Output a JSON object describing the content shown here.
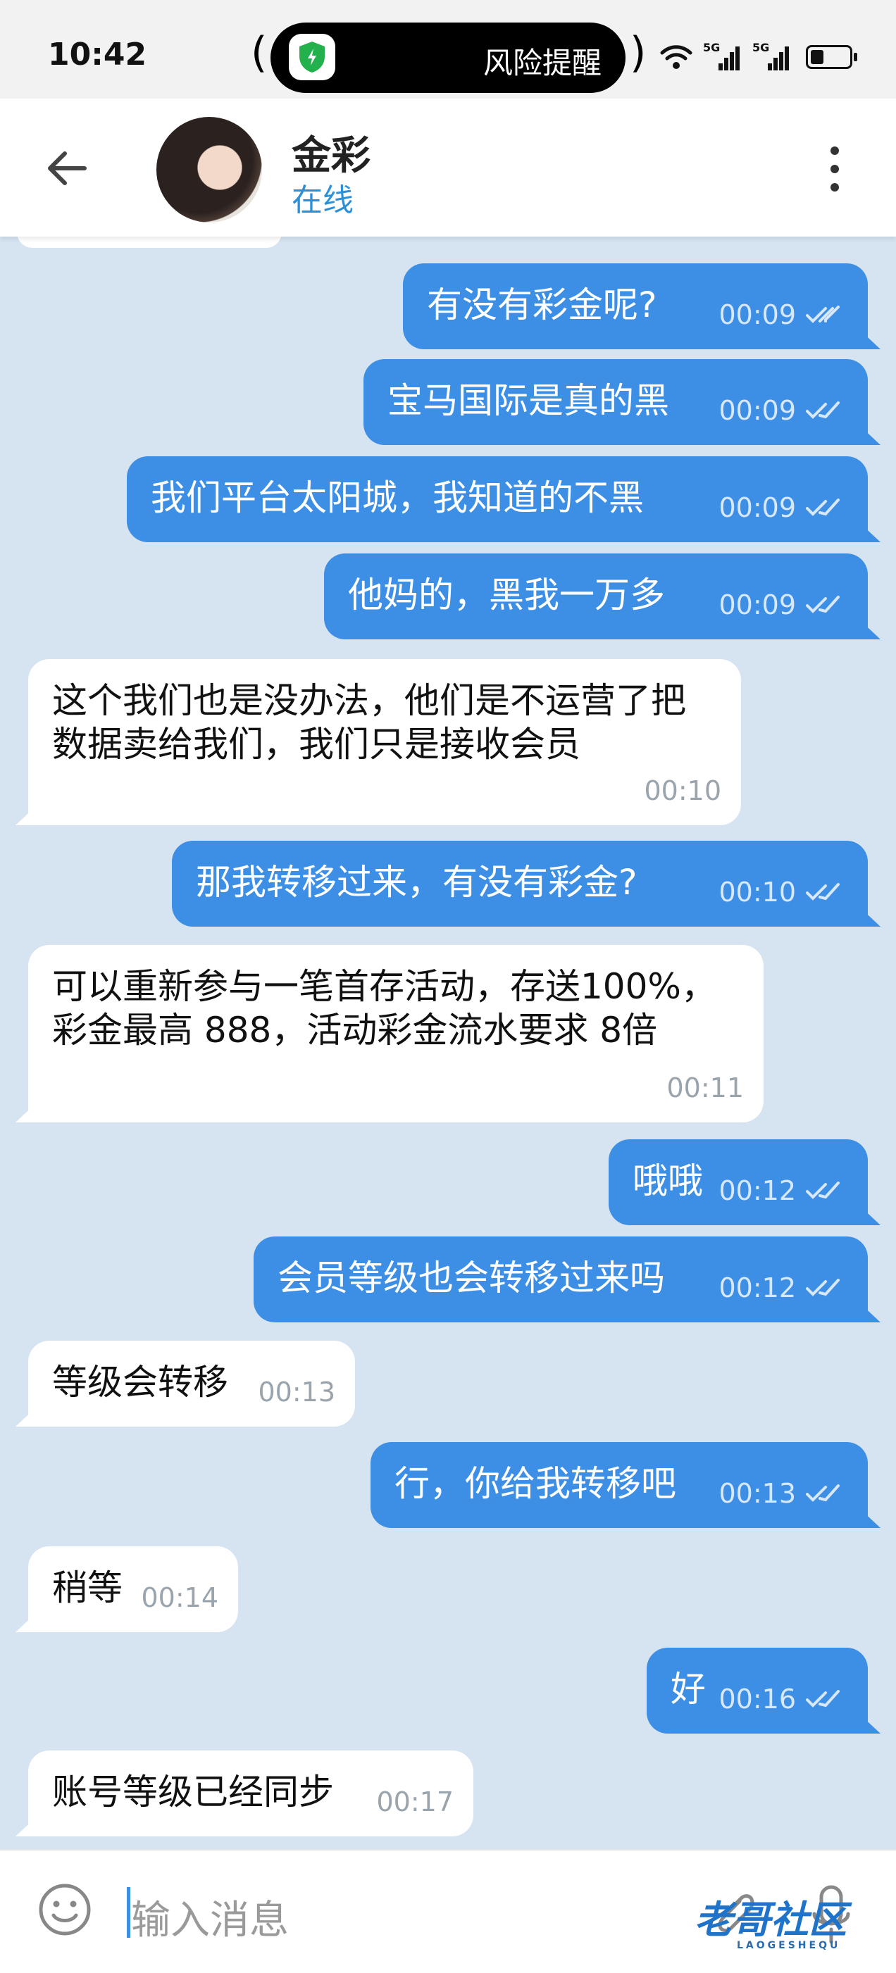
{
  "status_bar": {
    "time": "10:42",
    "alert_label": "风险提醒",
    "signal_1_label": "5G",
    "signal_2_label": "5G"
  },
  "header": {
    "contact_name": "金彩",
    "contact_status": "在线"
  },
  "messages": [
    {
      "dir": "out",
      "text": "有没有彩金呢?",
      "time": "00:09"
    },
    {
      "dir": "out",
      "text": "宝马国际是真的黑",
      "time": "00:09"
    },
    {
      "dir": "out",
      "text": "我们平台太阳城，我知道的不黑",
      "time": "00:09"
    },
    {
      "dir": "out",
      "text": "他妈的，黑我一万多",
      "time": "00:09"
    },
    {
      "dir": "in",
      "text": "这个我们也是没办法，他们是不运营了把数据卖给我们，我们只是接收会员",
      "time": "00:10"
    },
    {
      "dir": "out",
      "text": "那我转移过来，有没有彩金?",
      "time": "00:10"
    },
    {
      "dir": "in",
      "text": "可以重新参与一笔首存活动，存送100%，彩金最高 888，活动彩金流水要求 8倍",
      "time": "00:11"
    },
    {
      "dir": "out",
      "text": "哦哦",
      "time": "00:12"
    },
    {
      "dir": "out",
      "text": "会员等级也会转移过来吗",
      "time": "00:12"
    },
    {
      "dir": "in",
      "text": "等级会转移",
      "time": "00:13"
    },
    {
      "dir": "out",
      "text": "行，你给我转移吧",
      "time": "00:13"
    },
    {
      "dir": "in",
      "text": "稍等",
      "time": "00:14"
    },
    {
      "dir": "out",
      "text": "好",
      "time": "00:16"
    },
    {
      "dir": "in",
      "text": "账号等级已经同步",
      "time": "00:17"
    }
  ],
  "input": {
    "placeholder": "输入消息"
  },
  "watermark": {
    "text": "老哥社区",
    "subtext": "LAOGESHEQU"
  },
  "colors": {
    "outgoing_bubble": "#3d8fe6",
    "incoming_bubble": "#ffffff",
    "chat_background": "#d6e3f1",
    "status_online": "#2b8fd9"
  }
}
